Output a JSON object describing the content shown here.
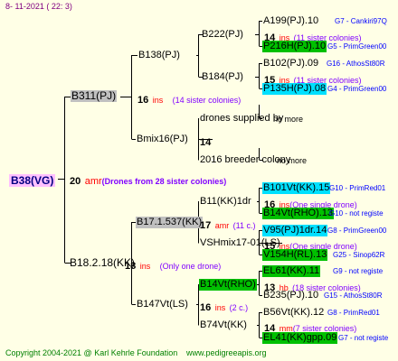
{
  "header": "8- 11-2021 ( 22: 3)",
  "footer": {
    "copyright": "Copyright 2004-2021 @ Karl Kehrle Foundation",
    "url": "www.pedigreeapis.org"
  },
  "root": {
    "label": "B38(VG)",
    "n": "20",
    "suffix": "amr",
    "note": "(Drones from 28 sister colonies)"
  },
  "g1": [
    {
      "label": "B311(PJ)",
      "n": "16",
      "suffix": "ins",
      "note": "(14 sister colonies)"
    },
    {
      "label": "B18.2.18(KK)",
      "n": "18",
      "suffix": "ins",
      "note": "(Only one drone)"
    }
  ],
  "g2": [
    {
      "label": "B138(PJ)",
      "n": "15",
      "suffix": "ins",
      "note": "(11 sister colonies)"
    },
    {
      "label": "Bmix16(PJ)",
      "n": "14",
      "suffix": "",
      "note": ""
    },
    {
      "label": "B17.1.537(KK)",
      "n": "17",
      "suffix": "amr",
      "note": "(11 c.)"
    },
    {
      "label": "B147Vt(LS)",
      "n": "16",
      "suffix": "ins",
      "note": "(2 c.)"
    }
  ],
  "g3": [
    {
      "label": "B222(PJ)",
      "n": "14",
      "suffix": "ins",
      "note": ""
    },
    {
      "label": "B184(PJ)",
      "n": "15",
      "suffix": "ins",
      "note": ""
    },
    {
      "label": "drones supplied by",
      "extra": "no more"
    },
    {
      "label": "2016 breeder colony",
      "extra": "no more"
    },
    {
      "label": "B11(KK)1dr",
      "n": "16",
      "suffix": "ins",
      "note": "(One single drone)"
    },
    {
      "label": "VSHmix17-01(LS)",
      "n": "15",
      "suffix": "ins",
      "note": "(One single drone)"
    },
    {
      "label": "B14Vt(RHO)",
      "n": "13",
      "suffix": "hb",
      "note": "(18 sister colonies)"
    },
    {
      "label": "B74Vt(KK)",
      "n": "14",
      "suffix": "mm",
      "note": "(7 sister colonies)"
    }
  ],
  "g4": [
    {
      "label": "A199(PJ).10",
      "tag": "G7 - Cankiri97Q"
    },
    {
      "label": "P216H(PJ).10",
      "tag": "G5 - PrimGreen00"
    },
    {
      "label": "B102(PJ).09",
      "tag": "G16 - AthosSt80R"
    },
    {
      "label": "P135H(PJ).08",
      "tag": "G4 - PrimGreen00"
    },
    {
      "label": "B101Vt(KK).15",
      "tag": "G10 - PrimRed01"
    },
    {
      "label": "B14Vt(RHO).13",
      "tag": "G10 - not registe"
    },
    {
      "label": "V95(PJ)1dr.14",
      "tag": "G8 - PrimGreen00"
    },
    {
      "label": "V154H(RL).13",
      "tag": "G25 - Sinop62R"
    },
    {
      "label": "EL61(KK).11",
      "tag": "G9 - not registe"
    },
    {
      "label": "B235(PJ).10",
      "tag": "G15 - AthosSt80R"
    },
    {
      "label": "B56Vt(KK).12",
      "tag": "G8 - PrimRed01"
    },
    {
      "label": "EL41(KK)gpp.09",
      "tag": "G7 - not registe"
    }
  ]
}
